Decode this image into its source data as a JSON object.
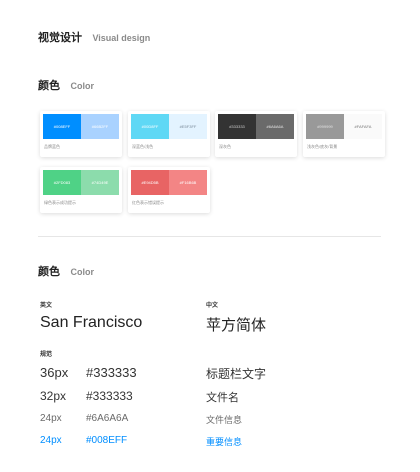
{
  "section1": {
    "title_cn": "视觉设计",
    "title_en": "Visual design"
  },
  "section2": {
    "title_cn": "颜色",
    "title_en": "Color"
  },
  "color_cards": [
    {
      "left": {
        "label": "#008EFF",
        "bg": "#008EFF",
        "text": "#ffffff"
      },
      "right": {
        "label": "#66B2FF",
        "bg": "#A9D2FF",
        "text": "#ffffff"
      },
      "caption": "品牌蓝色"
    },
    {
      "left": {
        "label": "#00D8FF",
        "bg": "#5FD8F5",
        "text": "#ffffff"
      },
      "right": {
        "label": "#E5F3FF",
        "bg": "#E3F3FF",
        "text": "#7a8a99"
      },
      "caption": "深蓝色/浅色"
    },
    {
      "left": {
        "label": "#333333",
        "bg": "#333333",
        "text": "#cccccc"
      },
      "right": {
        "label": "#6A6A6A",
        "bg": "#6A6A6A",
        "text": "#e5e5e5"
      },
      "caption": "深灰色"
    },
    {
      "left": {
        "label": "#999999",
        "bg": "#999999",
        "text": "#e0e0e0"
      },
      "right": {
        "label": "#FAFAFA",
        "bg": "#FAFAFA",
        "text": "#777777"
      },
      "caption": "浅灰色/底灰/背景"
    },
    {
      "left": {
        "label": "#2FD083",
        "bg": "#4FD286",
        "text": "#ffffff"
      },
      "right": {
        "label": "#74D49E",
        "bg": "#8CDCAC",
        "text": "#ffffff"
      },
      "caption": "绿色表示成功提示"
    },
    {
      "left": {
        "label": "#E94D5B",
        "bg": "#E86464",
        "text": "#ffffff"
      },
      "right": {
        "label": "#F16B6B",
        "bg": "#F38585",
        "text": "#ffffff"
      },
      "caption": "红色表示错误提示"
    }
  ],
  "section3": {
    "title_cn": "颜色",
    "title_en": "Color"
  },
  "fonts": {
    "en_label": "英文",
    "en_name": "San Francisco",
    "cn_label": "中文",
    "cn_name": "苹方简体"
  },
  "spec_label": "规范",
  "specs": [
    {
      "size": "36px",
      "color": "#333333",
      "desc": "标题栏文字",
      "hex": "#333333"
    },
    {
      "size": "32px",
      "color": "#333333",
      "desc": "文件名",
      "hex": "#333333"
    },
    {
      "size": "24px",
      "color": "#6A6A6A",
      "desc": "文件信息",
      "hex": "#6A6A6A"
    },
    {
      "size": "24px",
      "color": "#008EFF",
      "desc": "重要信息",
      "hex": "#008EFF"
    }
  ]
}
